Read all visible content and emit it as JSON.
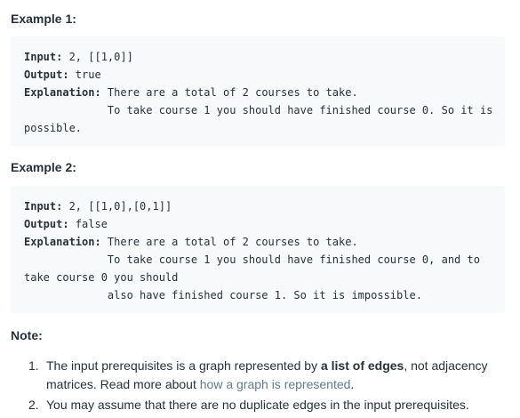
{
  "example1": {
    "title": "Example 1:",
    "input_label": "Input:",
    "input_value": " 2, [[1,0]]",
    "output_label": "Output:",
    "output_value": " true",
    "explanation_label": "Explanation:",
    "explanation_line1": " There are a total of 2 courses to take.",
    "explanation_line2": "             To take course 1 you should have finished course 0. So it is",
    "explanation_line3": "possible."
  },
  "example2": {
    "title": "Example 2:",
    "input_label": "Input:",
    "input_value": " 2, [[1,0],[0,1]]",
    "output_label": "Output:",
    "output_value": " false",
    "explanation_label": "Explanation:",
    "explanation_line1": " There are a total of 2 courses to take.",
    "explanation_line2": "             To take course 1 you should have finished course 0, and to",
    "explanation_line3": "take course 0 you should",
    "explanation_line4": "             also have finished course 1. So it is impossible."
  },
  "note": {
    "title": "Note:",
    "items": [
      {
        "number": "1.",
        "text_before": "The input prerequisites is a graph represented by ",
        "bold": "a list of edges",
        "text_middle": ", not adjacency matrices. Read more about ",
        "link": "how a graph is represented",
        "text_after": "."
      },
      {
        "number": "2.",
        "text": "You may assume that there are no duplicate edges in the input prerequisites."
      }
    ]
  },
  "colors": {
    "text": "#263238",
    "code_background": "#f7f9fa",
    "link": "#607d8b"
  }
}
